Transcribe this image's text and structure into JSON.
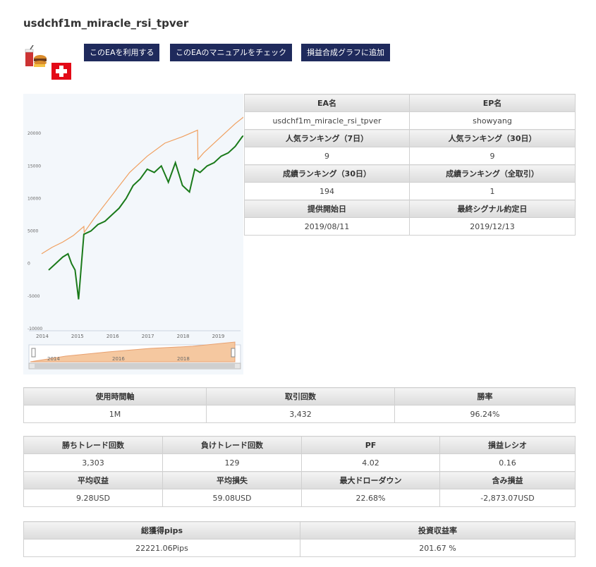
{
  "title": "usdchf1m_miracle_rsi_tpver",
  "buttons": {
    "use": "このEAを利用する",
    "manual": "このEAのマニュアルをチェック",
    "graph": "損益合成グラフに追加"
  },
  "info_table": {
    "rows": [
      {
        "left_label": "EA名",
        "left_value": "usdchf1m_miracle_rsi_tpver",
        "right_label": "EP名",
        "right_value": "showyang"
      },
      {
        "left_label": "人気ランキング（7日）",
        "left_value": "9",
        "right_label": "人気ランキング（30日）",
        "right_value": "9"
      },
      {
        "left_label": "成績ランキング（30日）",
        "left_value": "194",
        "right_label": "成績ランキング（全取引）",
        "right_value": "1"
      },
      {
        "left_label": "提供開始日",
        "left_value": "2019/08/11",
        "right_label": "最終シグナル約定日",
        "right_value": "2019/12/13"
      }
    ]
  },
  "stats1": {
    "headers": [
      "使用時間軸",
      "取引回数",
      "勝率"
    ],
    "values": [
      "1M",
      "3,432",
      "96.24%"
    ]
  },
  "stats2": {
    "headers1": [
      "勝ちトレード回数",
      "負けトレード回数",
      "PF",
      "損益レシオ"
    ],
    "values1": [
      "3,303",
      "129",
      "4.02",
      "0.16"
    ],
    "headers2": [
      "平均収益",
      "平均損失",
      "最大ドローダウン",
      "含み損益"
    ],
    "values2": [
      "9.28USD",
      "59.08USD",
      "22.68%",
      "-2,873.07USD"
    ]
  },
  "stats3": {
    "headers": [
      "総獲得pips",
      "投資収益率"
    ],
    "values": [
      "22221.06Pips",
      "201.67 %"
    ]
  },
  "chart_data": {
    "type": "line",
    "ylim": [
      -10000,
      25000
    ],
    "y_ticks": [
      "20000",
      "15000",
      "10000",
      "5000",
      "0",
      "-5000",
      "-10000"
    ],
    "x_ticks": [
      "2014",
      "2015",
      "2016",
      "2017",
      "2018",
      "2019"
    ],
    "navigator_ticks": [
      "2014",
      "2016",
      "2018"
    ],
    "series": [
      {
        "color": "#f0a060",
        "x": [
          2014.0,
          2014.3,
          2014.6,
          2014.9,
          2015.2,
          2015.21,
          2015.5,
          2016.0,
          2016.5,
          2017.0,
          2017.5,
          2018.0,
          2018.43,
          2018.44,
          2018.6,
          2019.0,
          2019.5,
          2019.85
        ],
        "values": [
          1500,
          2500,
          3300,
          4300,
          5700,
          4800,
          7000,
          10500,
          14000,
          16500,
          18500,
          19500,
          20500,
          16000,
          17000,
          19000,
          21500,
          23000
        ]
      },
      {
        "color": "#1a7a1a",
        "x": [
          2014.2,
          2014.4,
          2014.6,
          2014.75,
          2014.85,
          2014.95,
          2015.05,
          2015.2,
          2015.4,
          2015.6,
          2015.8,
          2016.0,
          2016.2,
          2016.4,
          2016.6,
          2016.8,
          2017.0,
          2017.2,
          2017.4,
          2017.6,
          2017.8,
          2018.0,
          2018.1,
          2018.2,
          2018.35,
          2018.5,
          2018.7,
          2018.9,
          2019.1,
          2019.3,
          2019.5,
          2019.7,
          2019.85
        ],
        "values": [
          -1000,
          0,
          1000,
          1500,
          0,
          -1000,
          -5500,
          4500,
          5000,
          6000,
          6500,
          7500,
          8500,
          10000,
          12000,
          13000,
          14500,
          14000,
          15000,
          12500,
          15500,
          12000,
          11500,
          11000,
          14500,
          14000,
          15000,
          15500,
          16500,
          17000,
          18000,
          19500,
          20000
        ]
      }
    ]
  }
}
